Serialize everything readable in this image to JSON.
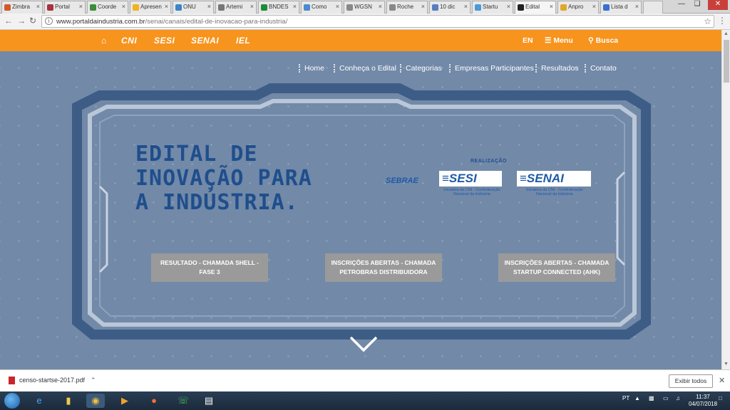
{
  "browser": {
    "tabs": [
      {
        "label": "Zimbra",
        "color": "#d05a2a"
      },
      {
        "label": "Portal",
        "color": "#a8323e"
      },
      {
        "label": "Coorde",
        "color": "#3b8e3b"
      },
      {
        "label": "Apresen",
        "color": "#f2b31b"
      },
      {
        "label": "ONU",
        "color": "#3a86c8"
      },
      {
        "label": "Artemi",
        "color": "#777777"
      },
      {
        "label": "BNDES",
        "color": "#1d8a3a"
      },
      {
        "label": "Como",
        "color": "#4a8ad0"
      },
      {
        "label": "WGSN",
        "color": "#888888"
      },
      {
        "label": "Roche",
        "color": "#888888"
      },
      {
        "label": "10 dic",
        "color": "#5a7cc0"
      },
      {
        "label": "Startu",
        "color": "#4a9ad6"
      },
      {
        "label": "Edital",
        "color": "#222222",
        "active": true
      },
      {
        "label": "Anpro",
        "color": "#e0a82a"
      },
      {
        "label": "Lista d",
        "color": "#3a6fd0"
      }
    ],
    "url_host": "www.portaldaindustria.com.br",
    "url_path": "/senai/canais/edital-de-inovacao-para-industria/"
  },
  "site_header": {
    "brands": [
      "CNI",
      "SESI",
      "SENAI",
      "IEL"
    ],
    "lang": "EN",
    "menu_label": "Menu",
    "search_label": "Busca"
  },
  "site_nav": [
    "Home",
    "Conheça o Edital",
    "Categorias",
    "Empresas Participantes",
    "Resultados",
    "Contato"
  ],
  "hero": {
    "title_lines": [
      "EDITAL DE",
      "INOVAÇÃO PARA",
      "A INDÚSTRIA."
    ],
    "realizacao_label": "REALIZAÇÃO",
    "sebrae_logo": "SEBRAE",
    "sesi_logo": "SESI",
    "sesi_sub": "Iniciativa da CNI - Confederação Nacional da Indústria",
    "senai_logo": "SENAI",
    "senai_sub": "Iniciativa da CNI - Confederação Nacional da Indústria",
    "cta": [
      "RESULTADO - CHAMADA SHELL - FASE 3",
      "INSCRIÇÕES ABERTAS - CHAMADA PETROBRAS DISTRIBUIDORA",
      "INSCRIÇÕES ABERTAS - CHAMADA STARTUP CONNECTED (AHK)"
    ],
    "title_color": "#1f4e8c"
  },
  "downloads": {
    "file_name": "censo-startse-2017.pdf",
    "show_all_label": "Exibir todos"
  },
  "taskbar": {
    "lang": "PT",
    "time": "11:37",
    "date": "04/07/2018"
  }
}
